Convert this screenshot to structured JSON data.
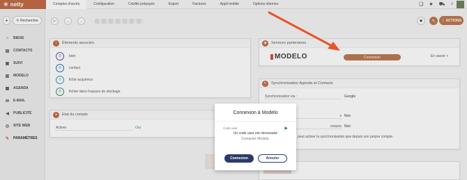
{
  "app": {
    "logo_text": "netty"
  },
  "topnav": [
    {
      "label": "Comptes d'accès",
      "active": true
    },
    {
      "label": "Configuration",
      "active": false
    },
    {
      "label": "Crédits prépayés",
      "active": false
    },
    {
      "label": "Export",
      "active": false
    },
    {
      "label": "Factures",
      "active": false
    },
    {
      "label": "Appli mobile",
      "active": false
    },
    {
      "label": "Options internes",
      "active": false
    }
  ],
  "sidebar": {
    "search_label": "Rechercher",
    "items": [
      {
        "label": "BIENS",
        "icon": "home-icon"
      },
      {
        "label": "CONTACTS",
        "icon": "contacts-icon"
      },
      {
        "label": "SUIVI",
        "icon": "suivi-icon"
      },
      {
        "label": "MODELO",
        "icon": "modelo-icon"
      },
      {
        "label": "AGENDA",
        "icon": "calendar-icon"
      },
      {
        "label": "E-MAIL",
        "icon": "mail-icon"
      },
      {
        "label": "PUBLICITÉ",
        "icon": "megaphone-icon"
      },
      {
        "label": "SITE WEB",
        "icon": "globe-icon"
      },
      {
        "label": "PARAMÈTRES",
        "icon": "wrench-icon"
      }
    ]
  },
  "header": {
    "actions_label": "ACTIONS"
  },
  "associated": {
    "title": "Éléments associés",
    "rows": [
      {
        "count": "0",
        "label": "bien",
        "color": "#5b4aa3"
      },
      {
        "count": "0",
        "label": "contact",
        "color": "#2a6ea8"
      },
      {
        "count": "0",
        "label": "fiche acquéreur",
        "color": "#2a9aa8"
      },
      {
        "count": "0",
        "label": "fichier dans l'espace de stockage",
        "color": "#3a8a6a"
      }
    ]
  },
  "account_status": {
    "title": "Etat du compte",
    "active_label": "Activer",
    "active_value": "Oui"
  },
  "partners": {
    "title": "Services partenaires",
    "logo": "MODELO",
    "connect_label": "Connexion",
    "more_label": "En savoir +"
  },
  "sync": {
    "title": "Synchronisation Agenda et Contacts",
    "sync_via_label": "Synchronisation via :",
    "sync_via_value": "Google",
    "value_2": "Non",
    "value_3": "Non",
    "row_2_label": "s",
    "row_3_label": "ontacts",
    "note": "peut activer la synchronisation que depuis son propre compte."
  },
  "modal": {
    "title": "Connexion à Modelo",
    "code_label": "Code user",
    "required_text": "Un code user est nécessaire",
    "contact_text": "Contacter Modelo.",
    "ok_label": "Connexion",
    "cancel_label": "Annuler"
  },
  "colors": {
    "brand": "#c0653d",
    "primary_button": "#2b3a6b",
    "arrow": "#e8552a"
  }
}
